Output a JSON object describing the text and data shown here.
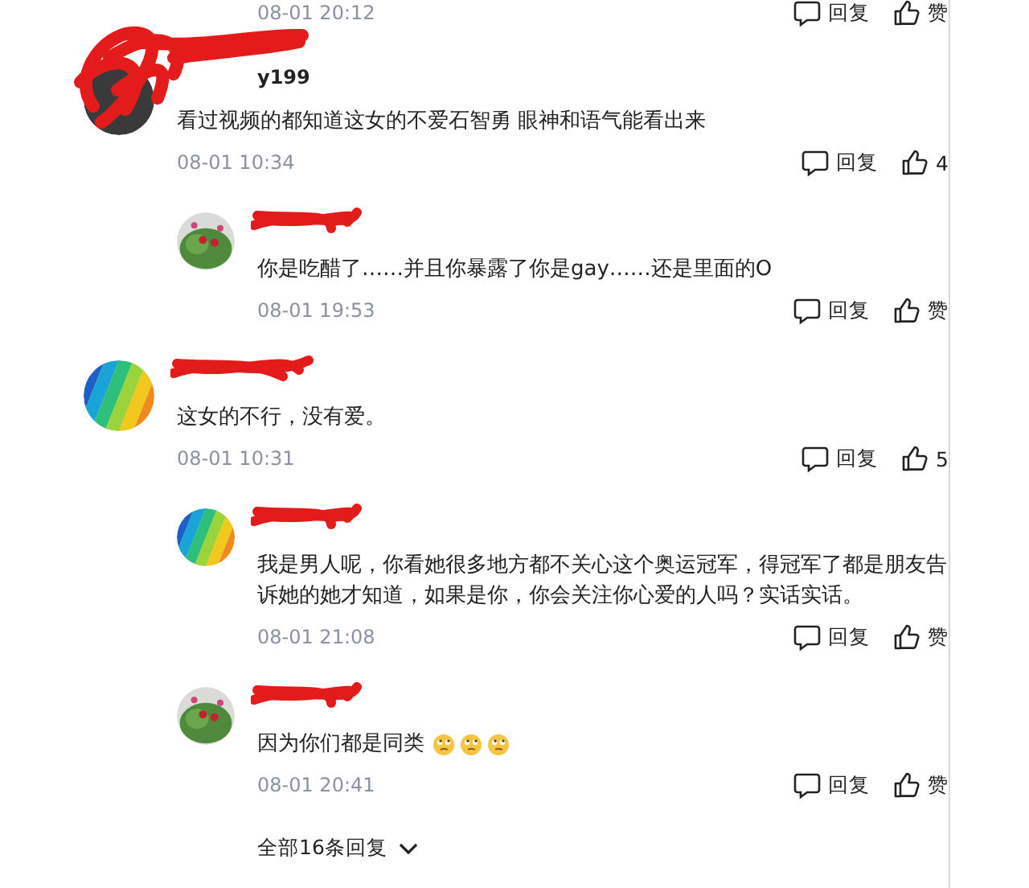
{
  "comments": [
    {
      "kind": "clipped",
      "time": "08-01 20:12",
      "reply_label": "回复",
      "like_label": "赞"
    },
    {
      "kind": "comment",
      "avatar": {
        "kind": "hidden"
      },
      "name": {
        "text": "y199",
        "redacted": true
      },
      "text": "看过视频的都知道这女的不爱石智勇 眼神和语气能看出来",
      "time": "08-01 10:34",
      "reply_label": "回复",
      "like_label": "4"
    },
    {
      "kind": "reply",
      "avatar": {
        "kind": "flower"
      },
      "name": {
        "redacted": true
      },
      "text": "你是吃醋了……并且你暴露了你是gay……还是里面的O",
      "time": "08-01 19:53",
      "reply_label": "回复",
      "like_label": "赞"
    },
    {
      "kind": "comment",
      "avatar": {
        "kind": "stripes"
      },
      "name": {
        "redacted": true
      },
      "text": "这女的不行，没有爱。",
      "time": "08-01 10:31",
      "reply_label": "回复",
      "like_label": "5"
    },
    {
      "kind": "reply",
      "avatar": {
        "kind": "stripes"
      },
      "name": {
        "redacted": true
      },
      "text": "我是男人呢，你看她很多地方都不关心这个奥运冠军，得冠军了都是朋友告诉她的她才知道，如果是你，你会关注你心爱的人吗？实话实话。",
      "time": "08-01 21:08",
      "reply_label": "回复",
      "like_label": "赞"
    },
    {
      "kind": "reply",
      "avatar": {
        "kind": "flower"
      },
      "name": {
        "redacted": true
      },
      "text": "因为你们都是同类",
      "emojis": [
        {
          "kind": "eye-roll"
        },
        {
          "kind": "eye-roll"
        },
        {
          "kind": "eye-roll"
        }
      ],
      "time": "08-01 20:41",
      "reply_label": "回复",
      "like_label": "赞"
    }
  ],
  "more_replies": {
    "label": "全部16条回复"
  }
}
